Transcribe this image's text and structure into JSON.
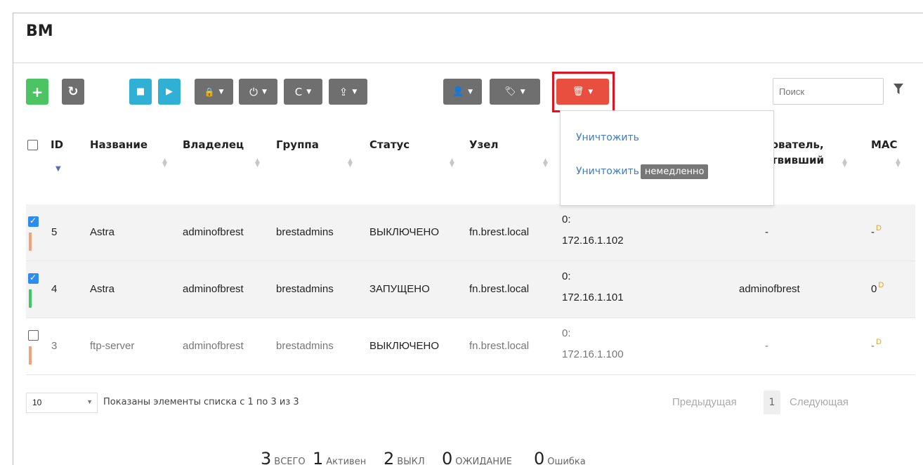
{
  "title": "ВМ",
  "search": {
    "placeholder": "Поиск"
  },
  "toolbar": {
    "add": "+",
    "refresh": "↻",
    "save": "■",
    "play": "▶",
    "lock": "🔒",
    "power": "⏻",
    "reboot": "C",
    "share": "⇪",
    "user": "👤",
    "tag": "🏷",
    "delete": "🗑",
    "caret": "▼"
  },
  "columns": {
    "id": "ID",
    "name": "Название",
    "owner": "Владелец",
    "group": "Группа",
    "status": "Статус",
    "host": "Узел",
    "user_a": "зователь,",
    "user_b": "ствивший",
    "mac": "MAC"
  },
  "dropdown": {
    "destroy": "Уничтожить",
    "destroy_now": "Уничтожить",
    "now_badge": "немедленно"
  },
  "rows": [
    {
      "id": "5",
      "name": "Astra",
      "owner": "adminofbrest",
      "group": "brestadmins",
      "status": "ВЫКЛЮЧЕНО",
      "host": "fn.brest.local",
      "ip_a": "0:",
      "ip_b": "172.16.1.102",
      "user": "-",
      "mac": "-",
      "flag": "D",
      "checked": true,
      "state_color": "#f5a07a"
    },
    {
      "id": "4",
      "name": "Astra",
      "owner": "adminofbrest",
      "group": "brestadmins",
      "status": "ЗАПУЩЕНО",
      "host": "fn.brest.local",
      "ip_a": "0:",
      "ip_b": "172.16.1.101",
      "user": "adminofbrest",
      "mac": "0",
      "flag": "D",
      "checked": true,
      "state_color": "#3cc864"
    },
    {
      "id": "3",
      "name": "ftp-server",
      "owner": "adminofbrest",
      "group": "brestadmins",
      "status": "ВЫКЛЮЧЕНО",
      "host": "fn.brest.local",
      "ip_a": "0:",
      "ip_b": "172.16.1.100",
      "user": "-",
      "mac": "-",
      "flag": "D",
      "checked": false,
      "state_color": "#f5a07a"
    }
  ],
  "footer": {
    "page_size": "10",
    "info": "Показаны элементы списка с 1 по 3 из 3",
    "prev": "Предыдущая",
    "page": "1",
    "next": "Следующая"
  },
  "totals": {
    "total_n": "3",
    "total_l": "ВСЕГО",
    "active_n": "1",
    "active_l": "Активен",
    "off_n": "2",
    "off_l": "ВЫКЛ",
    "pending_n": "0",
    "pending_l": "ОЖИДАНИЕ",
    "error_n": "0",
    "error_l": "Ошибка"
  }
}
